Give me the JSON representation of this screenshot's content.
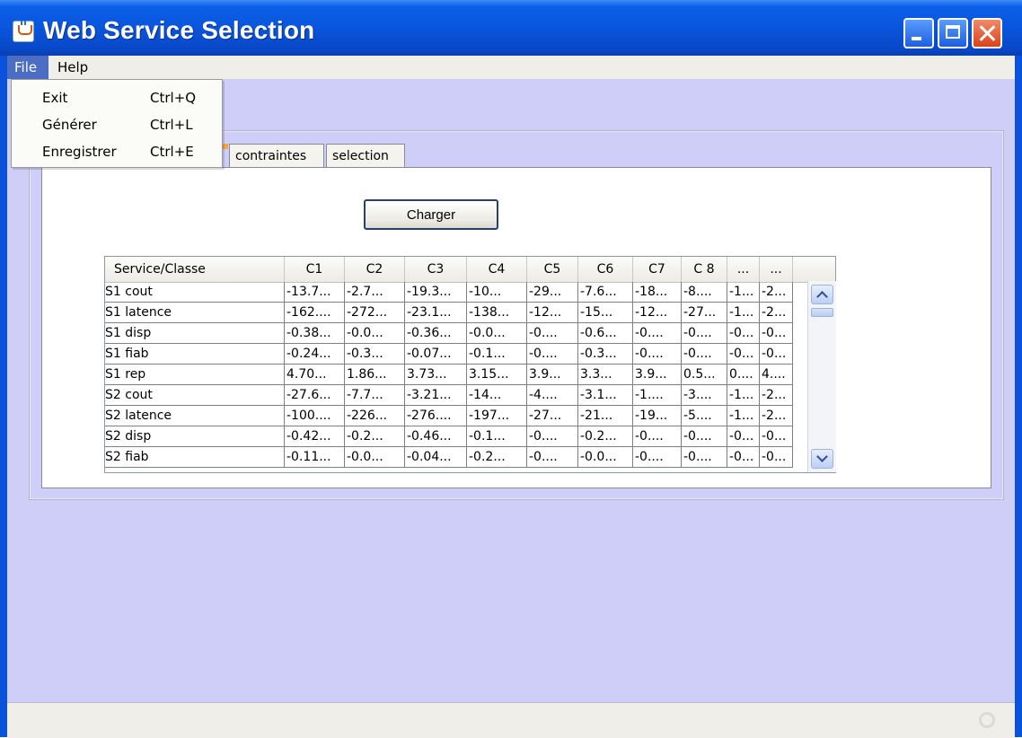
{
  "window": {
    "title": "Web Service Selection"
  },
  "menubar": {
    "file": "File",
    "help": "Help"
  },
  "file_menu": [
    {
      "label": "Exit",
      "accel": "Ctrl+Q"
    },
    {
      "label": "Générer",
      "accel": "Ctrl+L"
    },
    {
      "label": "Enregistrer",
      "accel": "Ctrl+E"
    }
  ],
  "tabs": [
    {
      "label": "contraintes"
    },
    {
      "label": "selection"
    }
  ],
  "charger_label": "Charger",
  "table": {
    "headers": [
      "Service/Classe",
      "C1",
      "C2",
      "C3",
      "C4",
      "C5",
      "C6",
      "C7",
      "C 8",
      "...",
      "..."
    ],
    "rows": [
      [
        "S1 cout",
        "-13.7...",
        "-2.7...",
        "-19.3...",
        "-10...",
        "-29...",
        "-7.6...",
        "-18...",
        "-8....",
        "-1...",
        "-2..."
      ],
      [
        "S1 latence",
        "-162....",
        "-272...",
        "-23.1...",
        "-138...",
        "-12...",
        "-15...",
        "-12...",
        "-27...",
        "-1...",
        "-2..."
      ],
      [
        "S1 disp",
        "-0.38...",
        "-0.0...",
        "-0.36...",
        "-0.0...",
        "-0....",
        "-0.6...",
        "-0....",
        "-0....",
        "-0...",
        "-0..."
      ],
      [
        "S1 fiab",
        "-0.24...",
        "-0.3...",
        "-0.07...",
        "-0.1...",
        "-0....",
        "-0.3...",
        "-0....",
        "-0....",
        "-0...",
        "-0..."
      ],
      [
        "S1 rep",
        "4.70...",
        "1.86...",
        "3.73...",
        "3.15...",
        "3.9...",
        "3.3...",
        "3.9...",
        "0.5...",
        "0....",
        "4...."
      ],
      [
        "S2 cout",
        "-27.6...",
        "-7.7...",
        "-3.21...",
        "-14...",
        "-4....",
        "-3.1...",
        "-1....",
        "-3....",
        "-1...",
        "-2..."
      ],
      [
        "S2 latence",
        "-100....",
        "-226...",
        "-276....",
        "-197...",
        "-27...",
        "-21...",
        "-19...",
        "-5....",
        "-1...",
        "-2..."
      ],
      [
        "S2 disp",
        "-0.42...",
        "-0.2...",
        "-0.46...",
        "-0.1...",
        "-0....",
        "-0.2...",
        "-0....",
        "-0....",
        "-0...",
        "-0..."
      ],
      [
        "S2 fiab",
        "-0.11...",
        "-0.0...",
        "-0.04...",
        "-0.2...",
        "-0....",
        "-0.0...",
        "-0....",
        "-0....",
        "-0...",
        "-0..."
      ]
    ]
  },
  "colors": {
    "titlebar": "#0a55dc",
    "content_bg": "#cecef8",
    "menu_active": "#4b6ec4"
  }
}
